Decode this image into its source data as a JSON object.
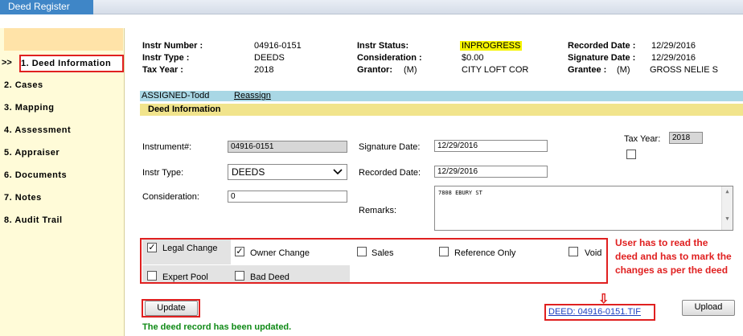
{
  "app": {
    "tab_title": "Deed Register"
  },
  "sidebar": {
    "indicator": ">>",
    "items": [
      {
        "label": "1. Deed Information",
        "active": true
      },
      {
        "label": "2. Cases"
      },
      {
        "label": "3. Mapping"
      },
      {
        "label": "4. Assessment"
      },
      {
        "label": "5. Appraiser"
      },
      {
        "label": "6. Documents"
      },
      {
        "label": "7. Notes"
      },
      {
        "label": "8. Audit Trail"
      }
    ]
  },
  "header": {
    "instr_number_label": "Instr Number :",
    "instr_number": "04916-0151",
    "instr_type_label": "Instr Type :",
    "instr_type": "DEEDS",
    "tax_year_label": "Tax Year :",
    "tax_year": "2018",
    "instr_status_label": "Instr Status:",
    "instr_status": "INPROGRESS",
    "consideration_label": "Consideration :",
    "consideration": "$0.00",
    "grantor_label": "Grantor:",
    "grantor_marker": "(M)",
    "grantor": "CITY LOFT COR",
    "recorded_date_label": "Recorded Date :",
    "recorded_date": "12/29/2016",
    "signature_date_label": "Signature Date :",
    "signature_date": "12/29/2016",
    "grantee_label": "Grantee :",
    "grantee_marker": "(M)",
    "grantee": "GROSS NELIE S"
  },
  "assign": {
    "text": "ASSIGNED-Todd",
    "link": "Reassign"
  },
  "section": {
    "title": "Deed Information"
  },
  "form": {
    "instrument_label": "Instrument#:",
    "instrument_value": "04916-0151",
    "instr_type_label": "Instr Type:",
    "instr_type_value": "DEEDS",
    "consideration_label": "Consideration:",
    "consideration_value": "0",
    "signature_date_label": "Signature Date:",
    "signature_date_value": "12/29/2016",
    "recorded_date_label": "Recorded Date:",
    "recorded_date_value": "12/29/2016",
    "remarks_label": "Remarks:",
    "remarks_value": "7808 EBURY ST",
    "tax_year_label": "Tax Year:",
    "tax_year_value": "2018"
  },
  "checks": {
    "legal_change": {
      "label": "Legal Change",
      "checked": true
    },
    "owner_change": {
      "label": "Owner Change",
      "checked": true
    },
    "sales": {
      "label": "Sales",
      "checked": false
    },
    "reference_only": {
      "label": "Reference Only",
      "checked": false
    },
    "void": {
      "label": "Void",
      "checked": false
    },
    "expert_pool": {
      "label": "Expert Pool",
      "checked": false
    },
    "bad_deed": {
      "label": "Bad Deed",
      "checked": false
    },
    "check_mark": "✓",
    "tax_year_checked": false
  },
  "annotation": {
    "line1": "User has to read the",
    "line2": "deed and has to mark the",
    "line3": "changes as per the deed",
    "arrow": "⇩"
  },
  "actions": {
    "update_label": "Update",
    "deed_link": "DEED: 04916-0151.TIF",
    "upload_label": "Upload",
    "status_message": "The deed record has been updated."
  },
  "colors": {
    "accent": "#3f86c7",
    "annotation_red": "#e02020",
    "success_green": "#0f8a16",
    "status_highlight": "#f6f400"
  }
}
